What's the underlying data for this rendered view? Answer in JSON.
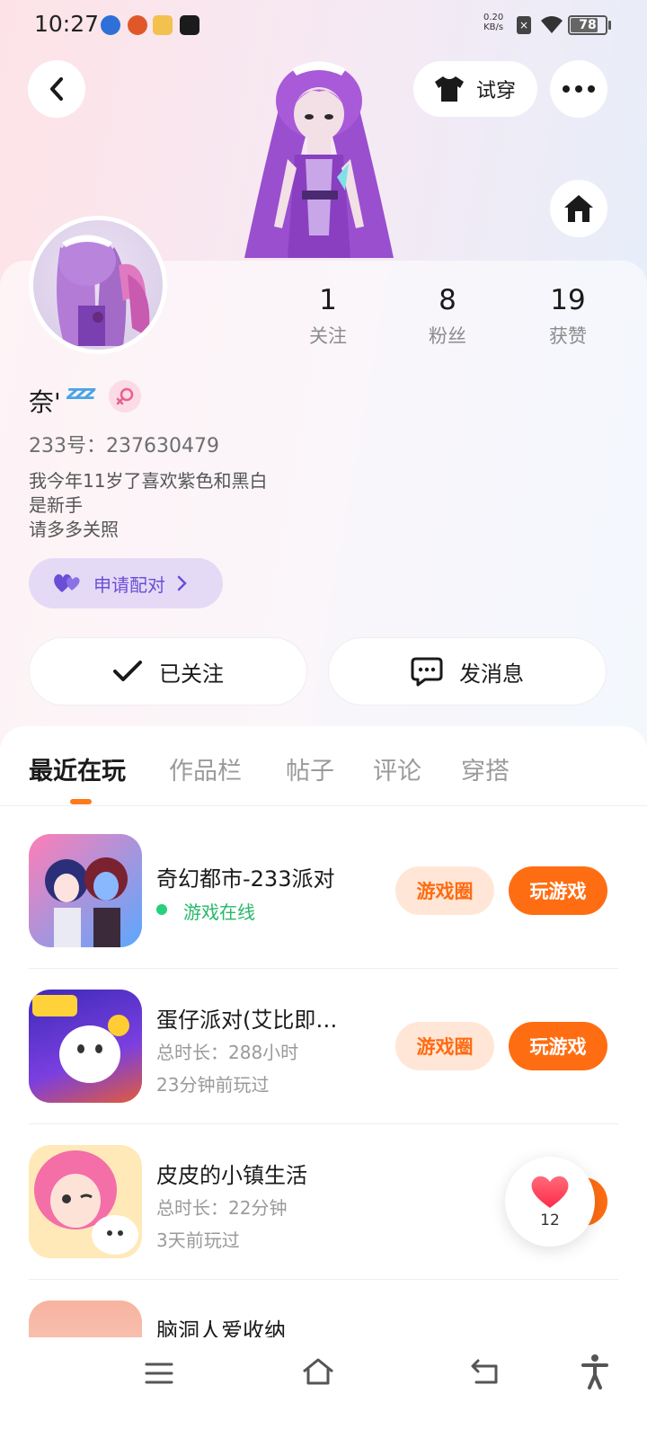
{
  "status_bar": {
    "time": "10:27",
    "net_speed_value": "0.20",
    "net_speed_unit": "KB/s",
    "battery": "78"
  },
  "header": {
    "tryon_label": "试穿"
  },
  "profile": {
    "nickname": "奈'",
    "nickname_emoji": "zzz",
    "uid_text": "233号：237630479",
    "bio_lines": [
      "我今年11岁了喜欢紫色和黑白",
      "是新手",
      "请多多关照"
    ],
    "pair_label": "申请配对",
    "stats": [
      {
        "value": "1",
        "label": "关注"
      },
      {
        "value": "8",
        "label": "粉丝"
      },
      {
        "value": "19",
        "label": "获赞"
      }
    ],
    "follow_label": "已关注",
    "message_label": "发消息"
  },
  "tabs": [
    {
      "label": "最近在玩",
      "active": true
    },
    {
      "label": "作品栏",
      "active": false
    },
    {
      "label": "帖子",
      "active": false
    },
    {
      "label": "评论",
      "active": false
    },
    {
      "label": "穿搭",
      "active": false
    }
  ],
  "games": [
    {
      "title": "奇幻都市-233派对",
      "line1": "游戏在线",
      "line2": "",
      "online": true,
      "circle_label": "游戏圈",
      "play_label": "玩游戏"
    },
    {
      "title": "蛋仔派对(艾比即…",
      "line1": "总时长：288小时",
      "line2": "23分钟前玩过",
      "online": false,
      "circle_label": "游戏圈",
      "play_label": "玩游戏"
    },
    {
      "title": "皮皮的小镇生活",
      "line1": "总时长：22分钟",
      "line2": "3天前玩过",
      "online": false
    },
    {
      "title": "脑洞人爱收纳"
    }
  ],
  "like_bubble": {
    "count": "12"
  },
  "colors": {
    "accent": "#ff6d12",
    "accent_light": "#ffe6d6",
    "online": "#27b86a",
    "pair_bg": "#e5daf6",
    "pair_text": "#6a4fd6"
  }
}
